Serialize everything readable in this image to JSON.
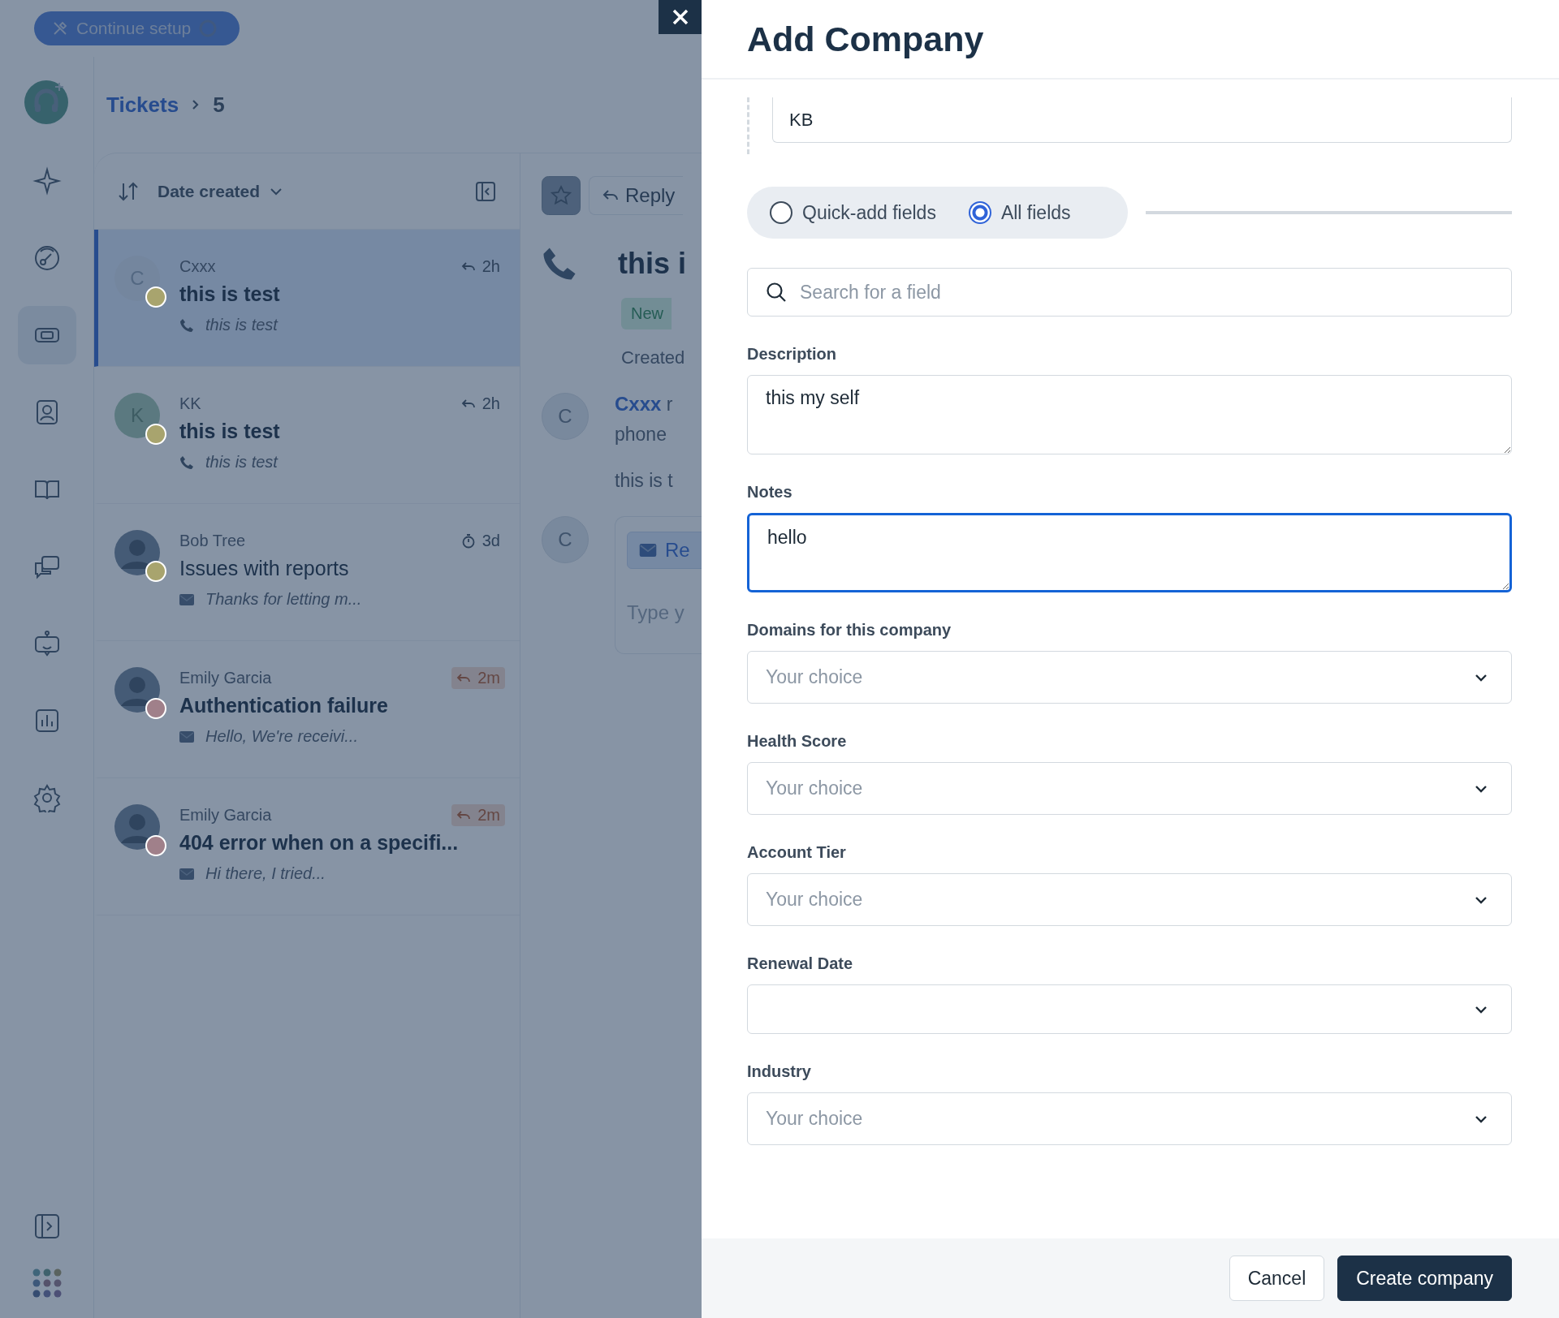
{
  "setup_button": {
    "label": "Continue setup"
  },
  "breadcrumb": [
    {
      "label": "Tickets"
    },
    {
      "label": "5"
    }
  ],
  "sidebar_nav": [
    {
      "selected": false
    },
    {
      "selected": false
    },
    {
      "selected": true
    },
    {
      "selected": false
    },
    {
      "selected": false
    },
    {
      "selected": false
    },
    {
      "selected": false
    },
    {
      "selected": false
    },
    {
      "selected": false
    }
  ],
  "ticket_list": {
    "sort_label": "Date created",
    "tickets": [
      {
        "requester": "Cxxx",
        "avatar_letter": "C",
        "color": "#a8a46e",
        "subject": "this is test",
        "unread": true,
        "preview": {
          "kind": "phone",
          "text": "this is test"
        },
        "time": {
          "kind": "reply",
          "text": "2h",
          "overdue": false
        },
        "selected": true
      },
      {
        "requester": "KK",
        "avatar_letter": "K",
        "color": "#a8a46e",
        "subject": "this is test",
        "unread": true,
        "preview": {
          "kind": "phone",
          "text": "this is test"
        },
        "time": {
          "kind": "reply",
          "text": "2h",
          "overdue": false
        },
        "selected": false
      },
      {
        "requester": "Bob Tree",
        "color": "#a8a46e",
        "subject": "Issues with reports",
        "unread": false,
        "preview": {
          "kind": "email",
          "text": "Thanks for letting m..."
        },
        "time": {
          "kind": "timer",
          "text": "3d",
          "overdue": false
        },
        "selected": false
      },
      {
        "requester": "Emily Garcia",
        "color": "#a0808a",
        "subject": "Authentication failure",
        "unread": true,
        "preview": {
          "kind": "email",
          "text": "Hello, We're receivi..."
        },
        "time": {
          "kind": "reply",
          "text": "2m",
          "overdue": true
        },
        "selected": false
      },
      {
        "requester": "Emily Garcia",
        "color": "#a0808a",
        "subject": "404 error when on a specifi...",
        "unread": true,
        "preview": {
          "kind": "email",
          "text": "Hi there, I tried..."
        },
        "time": {
          "kind": "reply",
          "text": "2m",
          "overdue": true
        },
        "selected": false
      }
    ]
  },
  "ticket_detail": {
    "reply_button": "Reply",
    "title": "this i",
    "status": "New",
    "created": "Created",
    "author": "Cxxx",
    "author_trail": "r",
    "body": "phone",
    "message": "this is t",
    "avatar_letters": [
      "C",
      "C"
    ],
    "reply_tab": "Re",
    "composer_placeholder": "Type y"
  },
  "drawer": {
    "title": "Add Company",
    "name_value": "KB",
    "field_modes": [
      {
        "label": "Quick-add fields",
        "selected": false
      },
      {
        "label": "All fields",
        "selected": true
      }
    ],
    "search": {
      "placeholder": "Search for a field"
    },
    "fields": [
      {
        "kind": "textarea",
        "label": "Description",
        "value": "this my self",
        "focused": false
      },
      {
        "kind": "textarea",
        "label": "Notes",
        "value": "hello",
        "focused": true
      },
      {
        "kind": "select",
        "label": "Domains for this company",
        "placeholder": "Your choice"
      },
      {
        "kind": "select",
        "label": "Health Score",
        "placeholder": "Your choice"
      },
      {
        "kind": "select",
        "label": "Account Tier",
        "placeholder": "Your choice"
      },
      {
        "kind": "date",
        "label": "Renewal Date"
      },
      {
        "kind": "select",
        "label": "Industry",
        "placeholder": "Your choice"
      }
    ],
    "buttons": [
      {
        "label": "Cancel",
        "kind": "secondary"
      },
      {
        "label": "Create company",
        "kind": "primary"
      }
    ]
  }
}
